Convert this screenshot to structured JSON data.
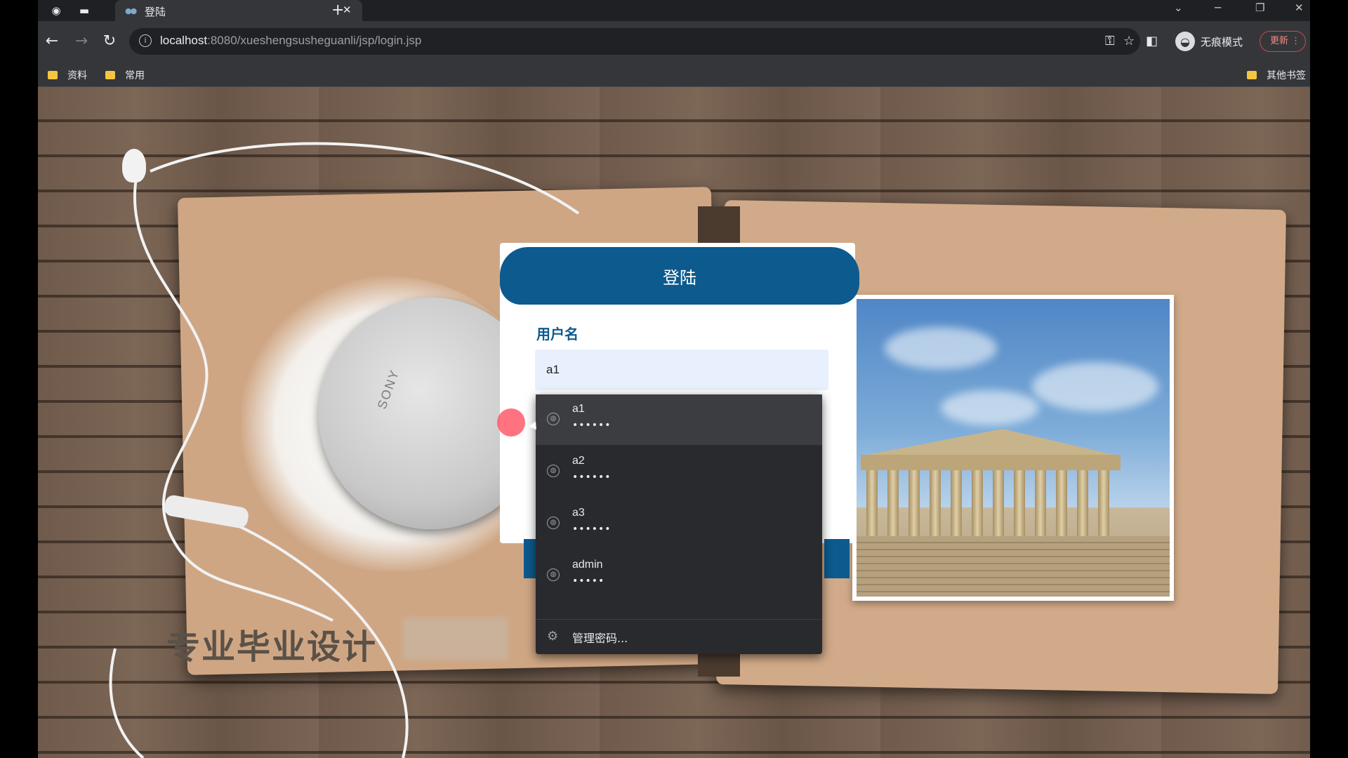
{
  "browser": {
    "tab_title": "登陆",
    "url_host": "localhost",
    "url_rest": ":8080/xueshengsusheguanli/jsp/login.jsp",
    "incognito_label": "无痕模式",
    "update_label": "更新",
    "icons": {
      "back": "arrow-left-icon",
      "forward": "arrow-right-icon",
      "reload": "reload-icon",
      "key": "key-icon",
      "star": "star-icon",
      "sidepanel": "side-panel-icon"
    }
  },
  "bookmarks": {
    "items": [
      {
        "label": "资料"
      },
      {
        "label": "常用"
      }
    ],
    "other_label": "其他书签"
  },
  "background": {
    "disc_brand": "SONY",
    "caption": "专业毕业设计"
  },
  "login": {
    "header_title": "登陆",
    "username_label": "用户名",
    "username_value": "a1"
  },
  "autofill": {
    "entries": [
      {
        "user": "a1",
        "password": "••••••"
      },
      {
        "user": "a2",
        "password": "••••••"
      },
      {
        "user": "a3",
        "password": "••••••"
      },
      {
        "user": "admin",
        "password": "•••••"
      }
    ],
    "manage_label": "管理密码..."
  },
  "colors": {
    "accent": "#0c5a8e",
    "dropdown_bg": "#292a2d",
    "input_autofill_bg": "#e8f0fe"
  }
}
